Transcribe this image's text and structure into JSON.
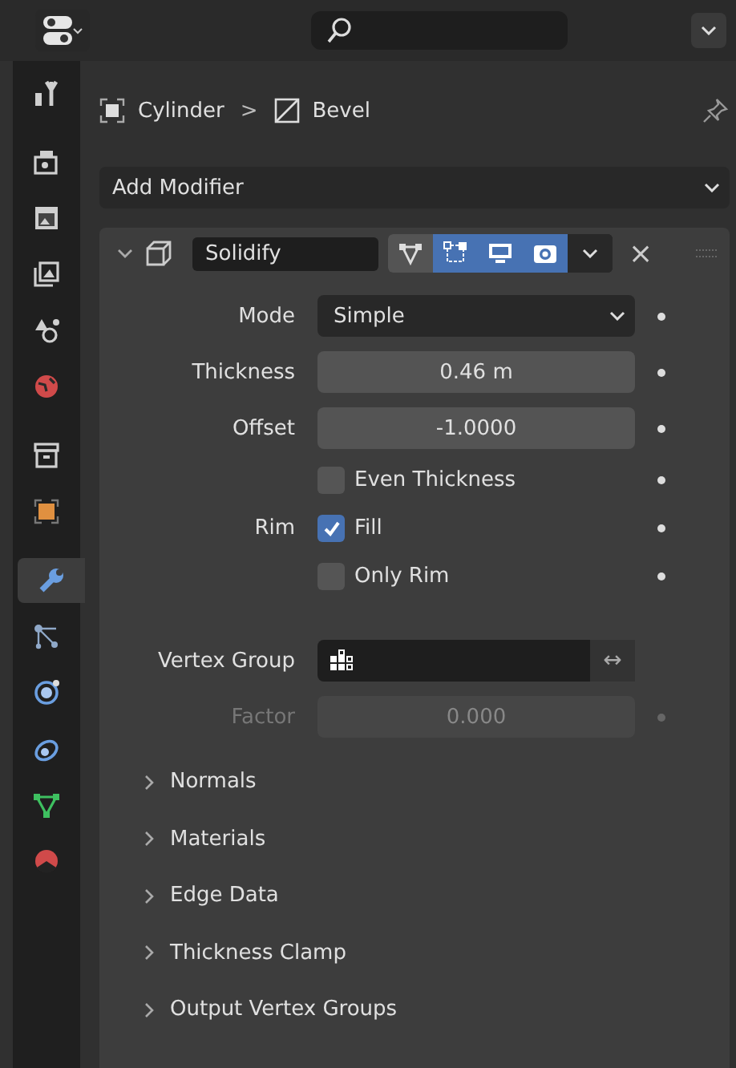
{
  "sidebar": {
    "items": [
      {
        "kind": "tool",
        "selected": false
      },
      {
        "kind": "render",
        "selected": false
      },
      {
        "kind": "output",
        "selected": false
      },
      {
        "kind": "view_layer",
        "selected": false
      },
      {
        "kind": "scene",
        "selected": false
      },
      {
        "kind": "world",
        "selected": false
      },
      {
        "kind": "collection",
        "selected": false
      },
      {
        "kind": "object",
        "selected": false
      },
      {
        "kind": "modifier",
        "selected": true
      },
      {
        "kind": "particles",
        "selected": false
      },
      {
        "kind": "physics",
        "selected": false
      },
      {
        "kind": "constraints",
        "selected": false
      },
      {
        "kind": "data",
        "selected": false
      },
      {
        "kind": "material",
        "selected": false
      }
    ]
  },
  "breadcrumb": {
    "object": "Cylinder",
    "separator": ">",
    "modifier": "Bevel"
  },
  "add_modifier": {
    "label": "Add Modifier"
  },
  "modifier": {
    "expanded": true,
    "name": "Solidify",
    "close": "×",
    "toggles": [
      {
        "kind": "cage",
        "on": false
      },
      {
        "kind": "edit",
        "on": true
      },
      {
        "kind": "viewport",
        "on": true
      },
      {
        "kind": "render",
        "on": true
      }
    ]
  },
  "properties": [
    {
      "kind": "dropdown",
      "label": "Mode",
      "value": "Simple"
    },
    {
      "kind": "number",
      "label": "Thickness",
      "value": "0.46 m",
      "disabled": false
    },
    {
      "kind": "number",
      "label": "Offset",
      "value": "-1.0000",
      "disabled": false
    },
    {
      "kind": "checkbox",
      "text": "Even Thickness",
      "checked": false
    },
    {
      "kind": "checkbox",
      "label": "Rim",
      "text": "Fill",
      "checked": true
    },
    {
      "kind": "checkbox",
      "text": "Only Rim",
      "checked": false
    },
    {
      "kind": "vertex_group",
      "label": "Vertex Group",
      "invert": "↔"
    },
    {
      "kind": "number",
      "label": "Factor",
      "value": "0.000",
      "disabled": true
    }
  ],
  "subpanels": [
    {
      "label": "Normals",
      "expanded": false
    },
    {
      "label": "Materials",
      "expanded": false
    },
    {
      "label": "Edge Data",
      "expanded": false
    },
    {
      "label": "Thickness Clamp",
      "expanded": false
    },
    {
      "label": "Output Vertex Groups",
      "expanded": false
    }
  ]
}
